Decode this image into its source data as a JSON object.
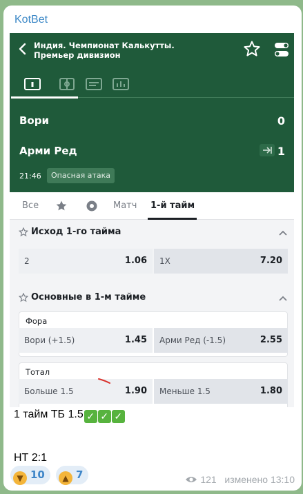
{
  "channel": {
    "name": "KotBet"
  },
  "header": {
    "league": "Индия. Чемпионат Калькутты. Премьер дивизион"
  },
  "match": {
    "home": {
      "name": "Вори",
      "score": "0"
    },
    "away": {
      "name": "Арми Ред",
      "score": "1"
    },
    "time": "21:46",
    "status": "Опасная атака"
  },
  "tabs": {
    "all": "Все",
    "match": "Матч",
    "first_half": "1-й тайм"
  },
  "section1": {
    "title": "Исход 1-го тайма",
    "odds": [
      {
        "label": "2",
        "value": "1.06"
      },
      {
        "label": "1X",
        "value": "7.20"
      }
    ]
  },
  "section2": {
    "title": "Основные в 1-м тайме",
    "handicap": {
      "title": "Фора",
      "odds": [
        {
          "label": "Вори (+1.5)",
          "value": "1.45"
        },
        {
          "label": "Арми Ред (-1.5)",
          "value": "2.55"
        }
      ]
    },
    "total": {
      "title": "Тотал",
      "odds": [
        {
          "label": "Больше 1.5",
          "value": "1.90"
        },
        {
          "label": "Меньше 1.5",
          "value": "1.80"
        }
      ]
    }
  },
  "message": {
    "line1": "1 тайм ТБ 1.5",
    "checks": [
      "✓",
      "✓",
      "✓"
    ],
    "line2": "НТ 2:1"
  },
  "reactions": [
    {
      "icon": "thumbs-down",
      "count": "10"
    },
    {
      "icon": "thumbs-up",
      "count": "7"
    }
  ],
  "meta": {
    "views": "121",
    "edited": "изменено 13:10"
  },
  "colors": {
    "header_green": "#1f5a3a",
    "link_blue": "#3a87c6",
    "check_green": "#57b33e"
  }
}
